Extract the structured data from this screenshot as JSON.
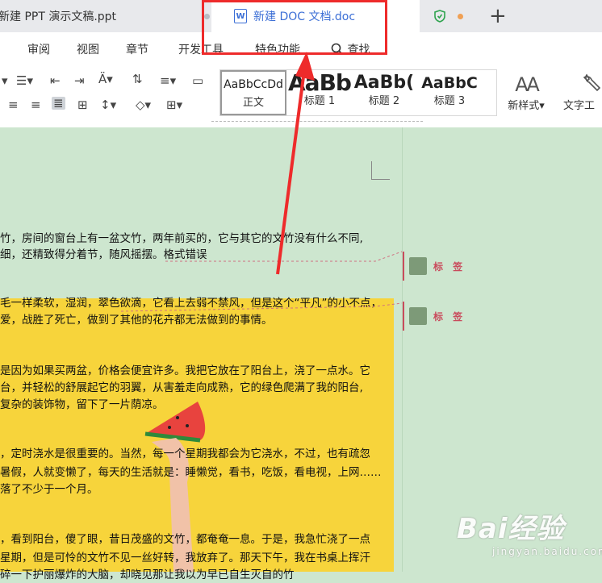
{
  "tabs": [
    {
      "label": "新建 PPT 演示文稿.ppt"
    },
    {
      "label": "新建 DOC 文档.doc",
      "icon_letter": "W"
    }
  ],
  "new_tab_label": "+",
  "menu": [
    "审阅",
    "视图",
    "章节",
    "开发工具",
    "特色功能",
    "查找"
  ],
  "styles": [
    {
      "sample": "AaBbCcDd",
      "label": "正文"
    },
    {
      "sample": "AaBb",
      "label": "标题 1"
    },
    {
      "sample": "AaBb(",
      "label": "标题 2"
    },
    {
      "sample": "AaBbC",
      "label": "标题 3"
    }
  ],
  "new_style": {
    "glyph": "AA",
    "label": "新样式"
  },
  "text_tool": {
    "label": "文字工"
  },
  "document_lines": [
    "竹，房间的窗台上有一盆文竹，两年前买的，它与其它的文竹没有什么不同,",
    "细，还精致得分着节，随风摇摆。格式错误",
    "毛一样柔软，湿润，翠色欲滴，它看上去弱不禁风，但是这个“平凡”的小不点，",
    "爱，战胜了死亡，做到了其他的花卉都无法做到的事情。",
    "是因为如果买两盆，价格会便宜许多。我把它放在了阳台上，浇了一点水。它",
    "台，并轻松的舒展起它的羽翼，从害羞走向成熟，它的绿色爬满了我的阳台,",
    "复杂的装饰物，留下了一片荫凉。",
    "，定时浇水是很重要的。当然，每一个星期我都会为它浇水，不过，也有疏忽",
    "暑假，人就变懒了，每天的生活就是：睡懒觉，看书，吃饭，看电视，上网……",
    "落了不少于一个月。",
    "，看到阳台，傻了眼，昔日茂盛的文竹，都奄奄一息。于是，我急忙浇了一点",
    "星期，但是可怜的文竹不见一丝好转，我放弃了。那天下午，我在书桌上挥汗",
    "碎一下护丽爆炸的大脑，却晓见那让我以为早已自生灭自的竹"
  ],
  "comments": [
    {
      "label": "标 签"
    },
    {
      "label": "标 签"
    }
  ],
  "watermark": {
    "main": "Bai经验",
    "sub": "jingyan.baidu.com"
  },
  "colors": {
    "accent": "#3c6fd6",
    "annotation_red": "#ee2b2b",
    "comment_red": "#c94b5c",
    "doc_background": "#cde6cf",
    "image_yellow": "#f7d43b"
  }
}
